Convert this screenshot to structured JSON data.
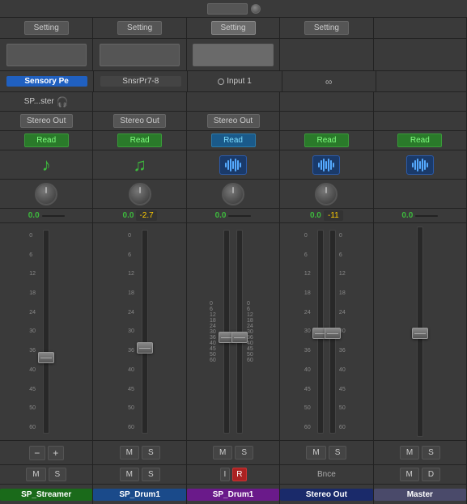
{
  "topBar": {
    "knobLabel": "knob"
  },
  "settingsRow": {
    "cells": [
      {
        "label": "Setting",
        "active": false
      },
      {
        "label": "Setting",
        "active": false
      },
      {
        "label": "Setting",
        "active": true
      },
      {
        "label": "Setting",
        "active": false
      },
      {
        "label": "",
        "active": false
      }
    ]
  },
  "pluginRow": {
    "cells": [
      {
        "hasPlugin": true
      },
      {
        "hasPlugin": true
      },
      {
        "hasPlugin": true
      },
      {
        "hasPlugin": false
      },
      {
        "hasPlugin": false
      }
    ]
  },
  "instrumentRow": {
    "cells": [
      {
        "label": "Sensory Pe",
        "type": "blue"
      },
      {
        "label": "SnsrPr7-8",
        "type": "dark"
      },
      {
        "label": "Input 1",
        "type": "input"
      },
      {
        "label": "∞",
        "type": "link"
      },
      {
        "label": "",
        "type": "empty"
      }
    ]
  },
  "monitorRow": {
    "cells": [
      {
        "label": "SP...ster",
        "hasKnob": true,
        "hasHeadphone": true
      },
      {
        "label": "",
        "hasKnob": false,
        "hasHeadphone": false
      },
      {
        "label": "",
        "hasKnob": false,
        "hasHeadphone": false
      },
      {
        "label": "",
        "hasKnob": false,
        "hasHeadphone": false
      },
      {
        "label": "",
        "hasKnob": false,
        "hasHeadphone": false
      }
    ]
  },
  "outputRow": {
    "cells": [
      {
        "label": "Stereo Out"
      },
      {
        "label": "Stereo Out"
      },
      {
        "label": "Stereo Out"
      },
      {
        "label": ""
      },
      {
        "label": ""
      }
    ]
  },
  "readRow": {
    "cells": [
      {
        "label": "Read",
        "type": "green"
      },
      {
        "label": "Read",
        "type": "green"
      },
      {
        "label": "Read",
        "type": "blue"
      },
      {
        "label": "Read",
        "type": "green"
      },
      {
        "label": "Read",
        "type": "green"
      }
    ]
  },
  "iconRow": {
    "cells": [
      {
        "type": "music-green"
      },
      {
        "type": "music-green"
      },
      {
        "type": "waveform-blue"
      },
      {
        "type": "waveform-blue"
      },
      {
        "type": "waveform-blue"
      }
    ]
  },
  "panRow": {
    "cells": [
      {
        "hasPan": true
      },
      {
        "hasPan": true
      },
      {
        "hasPan": true
      },
      {
        "hasPan": true
      },
      {
        "hasPan": false
      }
    ]
  },
  "panValRow": {
    "cells": [
      {
        "val1": "0.0",
        "val2": "",
        "val3": ""
      },
      {
        "val1": "0.0",
        "val2": "-2.7",
        "val3": ""
      },
      {
        "val1": "0.0",
        "val2": "",
        "val3": ""
      },
      {
        "val1": "0.0",
        "val2": "-11",
        "val3": ""
      },
      {
        "val1": "0.0",
        "val2": "",
        "val3": ""
      },
      {
        "val1": "0.0",
        "val2": "-2.7",
        "val3": ""
      },
      {
        "val1": "0.0",
        "val2": "",
        "val3": ""
      }
    ]
  },
  "faderRuler": [
    "",
    "6",
    "12",
    "18",
    "24",
    "30",
    "36",
    "40",
    "45",
    "50",
    "60"
  ],
  "bottomControls": {
    "cells": [
      {
        "type": "ms",
        "m": "M",
        "s": "S",
        "extra": "plusminus"
      },
      {
        "type": "ms",
        "m": "M",
        "s": "S",
        "extra": ""
      },
      {
        "type": "ms-ir",
        "m": "M",
        "s": "S",
        "i": "I",
        "r": "R"
      },
      {
        "type": "m-only",
        "m": "M",
        "extra": "bnce"
      },
      {
        "type": "md",
        "m": "M",
        "d": "D"
      }
    ]
  },
  "channelLabels": {
    "cells": [
      {
        "label": "SP_Streamer",
        "color": "green"
      },
      {
        "label": "SP_Drum1",
        "color": "blue"
      },
      {
        "label": "SP_Drum1",
        "color": "purple"
      },
      {
        "label": "Stereo Out",
        "color": "dark-blue"
      },
      {
        "label": "Master",
        "color": "gray"
      }
    ]
  },
  "panValues": [
    {
      "left": "0.0",
      "right": ""
    },
    {
      "left": "0.0",
      "right": "-2.7"
    },
    {
      "left": "0.0",
      "right": ""
    },
    {
      "left": "0.0",
      "right": "-11"
    },
    {
      "left": "0.0",
      "right": ""
    },
    {
      "left": "0.0",
      "right": "-2.7"
    },
    {
      "left": "0.0",
      "right": ""
    }
  ]
}
